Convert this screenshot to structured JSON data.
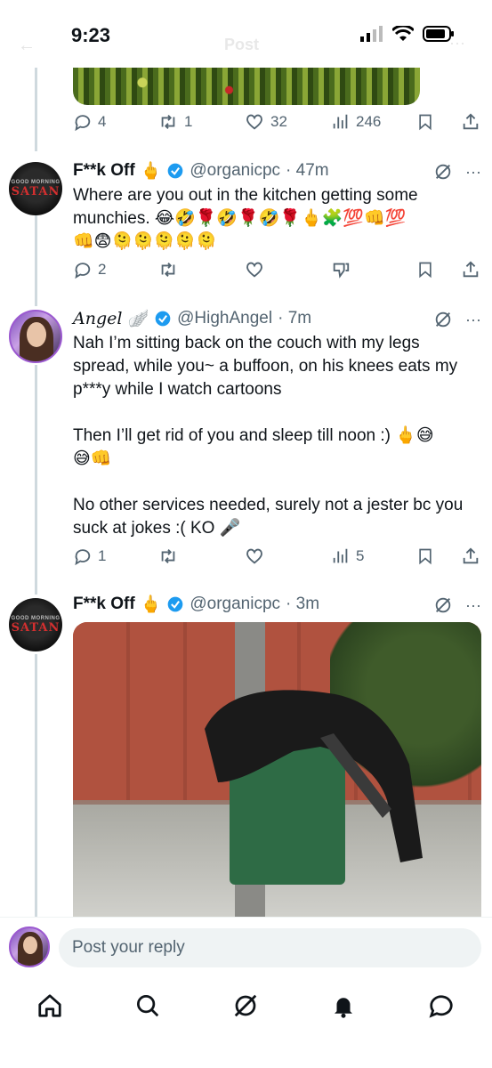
{
  "status": {
    "time": "9:23"
  },
  "header": {
    "title": "Post"
  },
  "prev_tweet_actions": {
    "replies": "4",
    "reposts": "1",
    "likes": "32",
    "views": "246"
  },
  "tweets": [
    {
      "name": "F**k Off",
      "name_emoji": "🖕",
      "handle": "@organicpc",
      "time": "· 47m",
      "avatar_text_top": "GOOD MORNING",
      "avatar_text": "SATAN",
      "text": "Where are you out in the kitchen getting some munchies. 😂🤣🌹🤣🌹🤣🌹🖕🧩💯👊💯\n👊😨🫠🫠🫠🫠🫠",
      "actions": {
        "replies": "2",
        "reposts": "",
        "likes": "",
        "views": ""
      }
    },
    {
      "name": "Angel",
      "name_emoji": "🪽",
      "handle": "@HighAngel",
      "time": "· 7m",
      "text": "Nah I’m sitting back on the couch with my legs spread, while you~ a buffoon, on his knees eats my p***y while I watch cartoons\n\nThen I’ll get rid of you and sleep till noon :) 🖕😅\n😅👊\n\nNo other services needed, surely not a jester bc you suck at jokes :( KO 🎤",
      "actions": {
        "replies": "1",
        "reposts": "",
        "likes": "",
        "views": "5"
      }
    },
    {
      "name": "F**k Off",
      "name_emoji": "🖕",
      "handle": "@organicpc",
      "time": "· 3m",
      "avatar_text_top": "GOOD MORNING",
      "avatar_text": "SATAN",
      "text": ""
    }
  ],
  "reply": {
    "placeholder": "Post your reply"
  },
  "nav": [
    "home-icon",
    "search-icon",
    "grok-icon",
    "notifications-icon",
    "messages-icon"
  ],
  "colors": {
    "verified": "#1d9bf0",
    "text": "#0f1419",
    "secondary": "#536471"
  }
}
